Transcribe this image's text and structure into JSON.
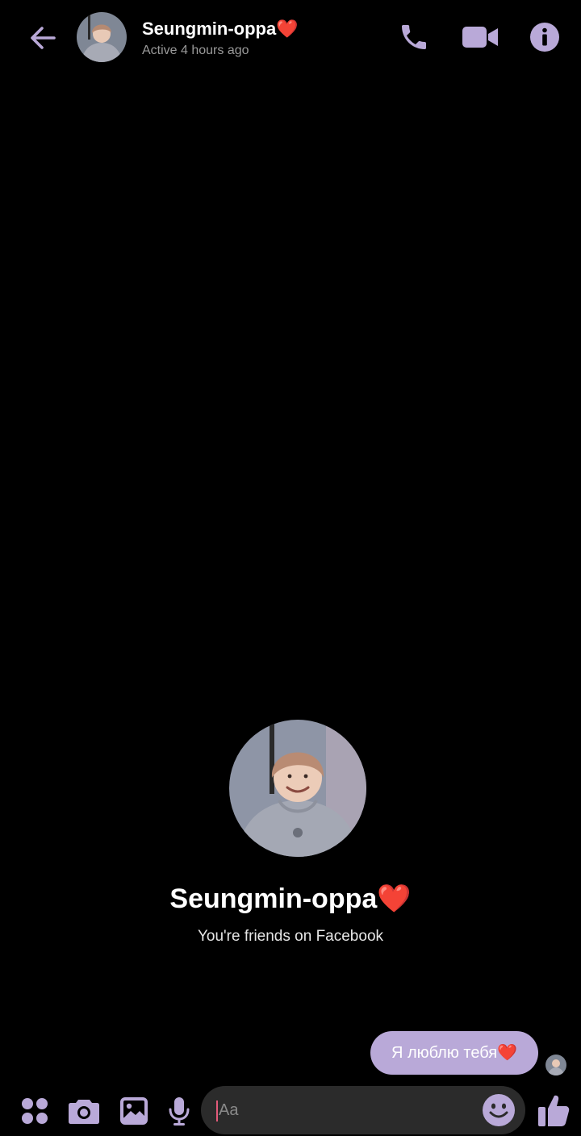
{
  "header": {
    "name": "Seungmin-oppa❤️",
    "status": "Active 4 hours ago"
  },
  "icons": {
    "back": "back-arrow-icon",
    "call": "phone-icon",
    "video": "video-camera-icon",
    "info": "info-icon",
    "apps": "apps-grid-icon",
    "camera": "camera-icon",
    "gallery": "gallery-icon",
    "mic": "microphone-icon",
    "emoji": "emoji-icon",
    "like": "thumbs-up-icon"
  },
  "profile": {
    "name": "Seungmin-oppa❤️",
    "subtitle": "You're friends on Facebook"
  },
  "messages": [
    {
      "text": "Я люблю тебя❤️",
      "sender": "me"
    }
  ],
  "composer": {
    "placeholder": "Aa"
  },
  "colors": {
    "accent": "#b9a9d8",
    "background": "#000000",
    "composer": "#2b2b2b"
  }
}
